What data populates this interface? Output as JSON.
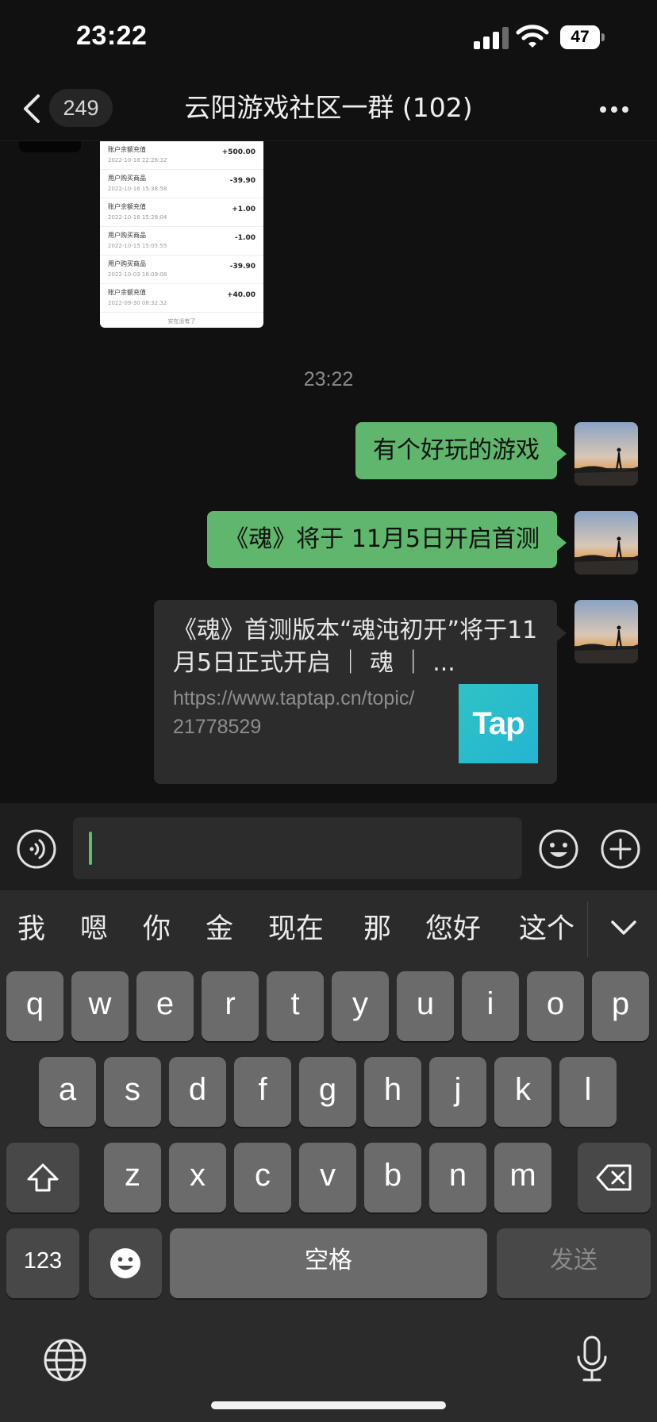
{
  "status_bar": {
    "time": "23:22",
    "battery": "47"
  },
  "nav": {
    "unread_count": "249",
    "title": "云阳游戏社区一群 (102)"
  },
  "chat": {
    "receipt": {
      "rows": [
        {
          "label": "账户余额充值",
          "date": "2022-10-18 22:26:32",
          "amount": "+500.00"
        },
        {
          "label": "用户购买商品",
          "date": "2022-10-16 15:38:58",
          "amount": "-39.90"
        },
        {
          "label": "账户余额充值",
          "date": "2022-10-16 15:28:04",
          "amount": "+1.00"
        },
        {
          "label": "用户购买商品",
          "date": "2022-10-15 15:05:55",
          "amount": "-1.00"
        },
        {
          "label": "用户购买商品",
          "date": "2022-10-03 16:09:08",
          "amount": "-39.90"
        },
        {
          "label": "账户余额充值",
          "date": "2022-09-30 08:32:32",
          "amount": "+40.00"
        }
      ],
      "end_text": "实在没有了"
    },
    "timestamp": "23:22",
    "messages": [
      {
        "text": "有个好玩的游戏"
      },
      {
        "text": "《魂》将于 11月5日开启首测"
      }
    ],
    "link_card": {
      "title": "《魂》首测版本“魂沌初开”将于11月5日正式开启 ｜ 魂 ｜ ...",
      "url": "https://www.taptap.cn/topic/21778529",
      "logo_text": "Tap"
    }
  },
  "input": {
    "value": ""
  },
  "keyboard": {
    "candidates": [
      "我",
      "嗯",
      "你",
      "金",
      "现在",
      "那",
      "您好",
      "这个"
    ],
    "row1": [
      "q",
      "w",
      "e",
      "r",
      "t",
      "y",
      "u",
      "i",
      "o",
      "p"
    ],
    "row2": [
      "a",
      "s",
      "d",
      "f",
      "g",
      "h",
      "j",
      "k",
      "l"
    ],
    "row3": [
      "z",
      "x",
      "c",
      "v",
      "b",
      "n",
      "m"
    ],
    "numbers_label": "123",
    "space_label": "空格",
    "send_label": "发送"
  },
  "colors": {
    "accent_green": "#5fb66c",
    "background": "#111111",
    "keyboard_background": "#2b2b2b"
  }
}
